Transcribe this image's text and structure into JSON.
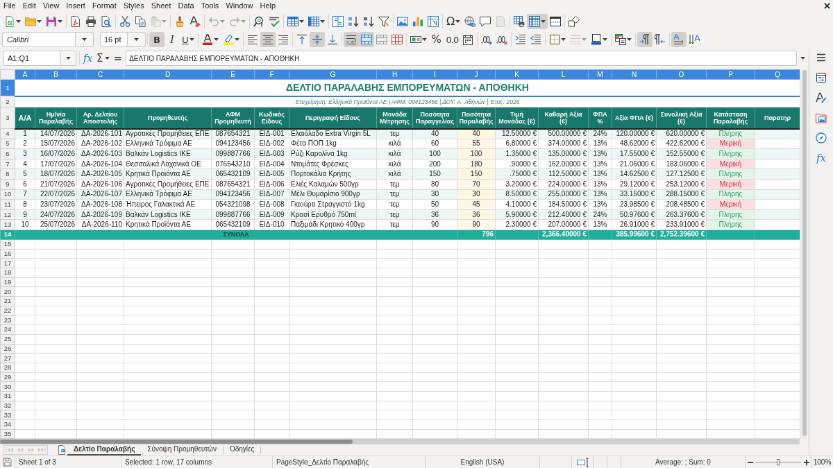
{
  "menu_bar": {
    "items": [
      "File",
      "Edit",
      "View",
      "Insert",
      "Format",
      "Styles",
      "Sheet",
      "Data",
      "Tools",
      "Window",
      "Help"
    ]
  },
  "standard_toolbar": {
    "groups": [
      [
        {
          "kind": "new",
          "on": false,
          "disabled": false
        },
        {
          "kind": "open",
          "on": false,
          "disabled": false
        },
        {
          "kind": "save",
          "on": false,
          "disabled": false
        }
      ],
      [
        {
          "kind": "pdf",
          "on": false,
          "disabled": false
        },
        {
          "kind": "print",
          "on": false,
          "disabled": false
        },
        {
          "kind": "preview",
          "on": false,
          "disabled": false
        }
      ],
      [
        {
          "kind": "cut",
          "on": false,
          "disabled": false
        },
        {
          "kind": "copy",
          "on": false,
          "disabled": false
        },
        {
          "kind": "paste",
          "on": false,
          "disabled": true
        }
      ],
      [
        {
          "kind": "clone",
          "on": false,
          "disabled": false
        },
        {
          "kind": "clear",
          "on": false,
          "disabled": false
        }
      ],
      [
        {
          "kind": "undo",
          "on": false,
          "disabled": true
        },
        {
          "kind": "redo",
          "on": false,
          "disabled": true
        }
      ],
      [
        {
          "kind": "find",
          "on": false,
          "disabled": false
        },
        {
          "kind": "spelling",
          "on": false,
          "disabled": false
        }
      ],
      [
        {
          "kind": "row",
          "on": false,
          "disabled": false
        },
        {
          "kind": "column",
          "on": false,
          "disabled": false
        }
      ],
      [
        {
          "kind": "sort",
          "on": false,
          "disabled": false
        },
        {
          "kind": "ascending",
          "on": false,
          "disabled": false
        },
        {
          "kind": "descending",
          "on": false,
          "disabled": false
        },
        {
          "kind": "filter",
          "on": false,
          "disabled": false
        }
      ],
      [
        {
          "kind": "image",
          "on": false,
          "disabled": false
        },
        {
          "kind": "chart",
          "on": false,
          "disabled": false
        },
        {
          "kind": "pivot",
          "on": false,
          "disabled": false
        }
      ],
      [
        {
          "kind": "special",
          "glyph": "Ω",
          "on": false,
          "disabled": false
        },
        {
          "kind": "link",
          "on": false,
          "disabled": false
        },
        {
          "kind": "comment",
          "on": false,
          "disabled": false
        },
        {
          "kind": "headerfooter",
          "on": false,
          "disabled": true
        }
      ],
      [
        {
          "kind": "printarea",
          "on": false,
          "disabled": false
        },
        {
          "kind": "freeze",
          "on": true,
          "disabled": false
        },
        {
          "kind": "split",
          "on": false,
          "disabled": false
        }
      ],
      [
        {
          "kind": "draw",
          "on": false,
          "disabled": false
        }
      ]
    ]
  },
  "formatting_toolbar": {
    "font_name": "Calibri",
    "font_size": "16 pt",
    "groups": [
      [
        {
          "kind": "bold",
          "glyph": "B",
          "on": true,
          "disabled": false
        },
        {
          "kind": "italic",
          "glyph": "I",
          "on": false,
          "disabled": false
        },
        {
          "kind": "underline",
          "glyph": "U",
          "on": false,
          "disabled": false
        }
      ],
      [
        {
          "kind": "fontcolor",
          "on": false,
          "disabled": false
        },
        {
          "kind": "highlight",
          "on": false,
          "disabled": false
        }
      ],
      [
        {
          "kind": "alignleft",
          "on": false,
          "disabled": false
        },
        {
          "kind": "aligncenter",
          "on": true,
          "disabled": false
        },
        {
          "kind": "alignright",
          "on": false,
          "disabled": false
        }
      ],
      [
        {
          "kind": "aligntop",
          "on": false,
          "disabled": false
        },
        {
          "kind": "alignmiddle",
          "on": true,
          "disabled": false
        },
        {
          "kind": "alignbottom",
          "on": false,
          "disabled": false
        }
      ],
      [
        {
          "kind": "wrap",
          "on": true,
          "disabled": false
        },
        {
          "kind": "mergecenter",
          "on": true,
          "disabled": false
        },
        {
          "kind": "merge",
          "on": false,
          "disabled": false
        },
        {
          "kind": "unmerge",
          "on": false,
          "disabled": false
        }
      ],
      [
        {
          "kind": "currency",
          "on": false,
          "disabled": false
        },
        {
          "kind": "percent",
          "glyph": "%",
          "on": false,
          "disabled": false
        },
        {
          "kind": "number",
          "glyph": "0.0",
          "on": false,
          "disabled": false
        },
        {
          "kind": "date",
          "on": false,
          "disabled": false
        }
      ],
      [
        {
          "kind": "adddecimal",
          "on": false,
          "disabled": false
        },
        {
          "kind": "deletedecimal",
          "on": false,
          "disabled": false
        }
      ],
      [
        {
          "kind": "indent",
          "on": false,
          "disabled": false
        },
        {
          "kind": "outdent",
          "on": false,
          "disabled": false
        }
      ],
      [
        {
          "kind": "borders",
          "on": false,
          "disabled": false
        },
        {
          "kind": "borderstyle",
          "on": false,
          "disabled": true
        },
        {
          "kind": "bordercolor",
          "on": false,
          "disabled": false
        }
      ],
      [
        {
          "kind": "conditional",
          "on": false,
          "disabled": false
        }
      ],
      [
        {
          "kind": "ltr",
          "on": true,
          "disabled": false
        },
        {
          "kind": "rtl",
          "on": false,
          "disabled": false
        }
      ],
      [
        {
          "kind": "textdirection",
          "on": true,
          "disabled": false
        },
        {
          "kind": "verticaltext",
          "on": false,
          "disabled": false
        }
      ]
    ]
  },
  "formula_bar": {
    "name_box": "A1:Q1",
    "function_wizard": "fx",
    "sum": "Σ",
    "formula": "=",
    "content": "ΔΕΛΤΙΟ ΠΑΡΑΛΑΒΗΣ ΕΜΠΟΡΕΥΜΑΤΩΝ - ΑΠΟΘΗΚΗ"
  },
  "sheet": {
    "column_headers": [
      {
        "label": "A",
        "selected": true
      },
      {
        "label": "B",
        "selected": true
      },
      {
        "label": "C",
        "selected": true
      },
      {
        "label": "D",
        "selected": true
      },
      {
        "label": "E",
        "selected": true
      },
      {
        "label": "F",
        "selected": true
      },
      {
        "label": "G",
        "selected": true
      },
      {
        "label": "H",
        "selected": true
      },
      {
        "label": "I",
        "selected": true
      },
      {
        "label": "J",
        "selected": true
      },
      {
        "label": "K",
        "selected": true
      },
      {
        "label": "L",
        "selected": true
      },
      {
        "label": "M",
        "selected": true
      },
      {
        "label": "N",
        "selected": true
      },
      {
        "label": "O",
        "selected": true
      },
      {
        "label": "P",
        "selected": true
      },
      {
        "label": "Q",
        "selected": true
      }
    ],
    "row_headers": [
      {
        "label": "1",
        "selected": true
      },
      {
        "label": "2",
        "selected": false
      },
      {
        "label": "3",
        "selected": false
      },
      {
        "label": "4",
        "selected": false
      },
      {
        "label": "5",
        "selected": false
      },
      {
        "label": "6",
        "selected": false
      },
      {
        "label": "7",
        "selected": false
      },
      {
        "label": "8",
        "selected": false
      },
      {
        "label": "9",
        "selected": false
      },
      {
        "label": "10",
        "selected": false
      },
      {
        "label": "11",
        "selected": false
      },
      {
        "label": "12",
        "selected": false
      },
      {
        "label": "13",
        "selected": false
      },
      {
        "label": "14",
        "selected": false
      },
      {
        "label": "15",
        "selected": false
      },
      {
        "label": "16",
        "selected": false
      },
      {
        "label": "17",
        "selected": false
      },
      {
        "label": "18",
        "selected": false
      },
      {
        "label": "19",
        "selected": false
      },
      {
        "label": "20",
        "selected": false
      },
      {
        "label": "21",
        "selected": false
      },
      {
        "label": "22",
        "selected": false
      },
      {
        "label": "23",
        "selected": false
      },
      {
        "label": "24",
        "selected": false
      },
      {
        "label": "25",
        "selected": false
      },
      {
        "label": "26",
        "selected": false
      },
      {
        "label": "27",
        "selected": false
      },
      {
        "label": "28",
        "selected": false
      },
      {
        "label": "29",
        "selected": false
      },
      {
        "label": "30",
        "selected": false
      },
      {
        "label": "31",
        "selected": false
      },
      {
        "label": "32",
        "selected": false
      },
      {
        "label": "33",
        "selected": false
      },
      {
        "label": "34",
        "selected": false
      },
      {
        "label": "35",
        "selected": false
      }
    ],
    "title": "ΔΕΛΤΙΟ ΠΑΡΑΛΑΒΗΣ ΕΜΠΟΡΕΥΜΑΤΩΝ - ΑΠΟΘΗΚΗ",
    "subtitle": "Επιχείρηση: Ελληνικά Προϊόντα ΑΕ | ΑΦΜ: 094123456 | ΔΟΥ: Α΄ Αθηνών | Έτος: 2026",
    "columns": [
      "Α/Α",
      "Ημ/νία Παραλαβής",
      "Αρ. Δελτίου Αποστολής",
      "Προμηθευτής",
      "ΑΦΜ Προμηθευτή",
      "Κωδικός Είδους",
      "Περιγραφή Είδους",
      "Μονάδα Μέτρησης",
      "Ποσότητα Παραγγελίας",
      "Ποσότητα Παραλαβής",
      "Τιμή Μονάδας (€)",
      "Καθαρή Αξία (€)",
      "ΦΠΑ %",
      "Αξία ΦΠΑ (€)",
      "Συνολική Αξία (€)",
      "Κατάσταση Παραλαβής",
      "Παρατηρ"
    ],
    "rows": [
      {
        "number": "1",
        "date": "14/07/2026",
        "delivery_note": "ΔΑ-2026-101",
        "supplier": "Αγροτικές Προμήθειες ΕΠΕ",
        "vat_number": "087654321",
        "item_code": "ΕΙΔ-001",
        "description": "Ελαιόλαδο Extra Virgin 5L",
        "unit": "τεμ",
        "qty_ordered": "40",
        "qty_received": "40",
        "unit_price": "12.50000 €",
        "net_value": "500.00000 €",
        "vat_rate": "24%",
        "vat_amount": "120.00000 €",
        "total": "620.00000 €",
        "status": {
          "label": "Πλήρης",
          "kind": "complete"
        }
      },
      {
        "number": "2",
        "date": "15/07/2026",
        "delivery_note": "ΔΑ-2026-102",
        "supplier": "Ελληνικά Τρόφιμα ΑΕ",
        "vat_number": "094123456",
        "item_code": "ΕΙΔ-002",
        "description": "Φέτα ΠΟΠ 1kg",
        "unit": "κιλά",
        "qty_ordered": "60",
        "qty_received": "55",
        "unit_price": "6.80000 €",
        "net_value": "374.00000 €",
        "vat_rate": "13%",
        "vat_amount": "48.62000 €",
        "total": "422.62000 €",
        "status": {
          "label": "Μερική",
          "kind": "partial"
        }
      },
      {
        "number": "3",
        "date": "16/07/2026",
        "delivery_note": "ΔΑ-2026-103",
        "supplier": "Βαλκάν Logistics ΙΚΕ",
        "vat_number": "099887766",
        "item_code": "ΕΙΔ-003",
        "description": "Ρύζι Καρολίνα 1kg",
        "unit": "κιλά",
        "qty_ordered": "100",
        "qty_received": "100",
        "unit_price": "1.35000 €",
        "net_value": "135.00000 €",
        "vat_rate": "13%",
        "vat_amount": "17.55000 €",
        "total": "152.55000 €",
        "status": {
          "label": "Πλήρης",
          "kind": "complete"
        }
      },
      {
        "number": "4",
        "date": "17/07/2026",
        "delivery_note": "ΔΑ-2026-104",
        "supplier": "Θεσσαλικά Λαχανικά ΟΕ",
        "vat_number": "076543210",
        "item_code": "ΕΙΔ-004",
        "description": "Ντομάτες Φρέσκες",
        "unit": "κιλά",
        "qty_ordered": "200",
        "qty_received": "180",
        "unit_price": ".90000 €",
        "net_value": "162.00000 €",
        "vat_rate": "13%",
        "vat_amount": "21.06000 €",
        "total": "183.06000 €",
        "status": {
          "label": "Μερική",
          "kind": "partial"
        }
      },
      {
        "number": "5",
        "date": "18/07/2026",
        "delivery_note": "ΔΑ-2026-105",
        "supplier": "Κρητικά Προϊόντα ΑΕ",
        "vat_number": "065432109",
        "item_code": "ΕΙΔ-005",
        "description": "Πορτοκάλια Κρήτης",
        "unit": "κιλά",
        "qty_ordered": "150",
        "qty_received": "150",
        "unit_price": ".75000 €",
        "net_value": "112.50000 €",
        "vat_rate": "13%",
        "vat_amount": "14.62500 €",
        "total": "127.12500 €",
        "status": {
          "label": "Πλήρης",
          "kind": "complete"
        }
      },
      {
        "number": "6",
        "date": "21/07/2026",
        "delivery_note": "ΔΑ-2026-106",
        "supplier": "Αγροτικές Προμήθειες ΕΠΕ",
        "vat_number": "087654321",
        "item_code": "ΕΙΔ-006",
        "description": "Ελιές Καλαμών 500γρ",
        "unit": "τεμ",
        "qty_ordered": "80",
        "qty_received": "70",
        "unit_price": "3.20000 €",
        "net_value": "224.00000 €",
        "vat_rate": "13%",
        "vat_amount": "29.12000 €",
        "total": "253.12000 €",
        "status": {
          "label": "Μερική",
          "kind": "partial"
        }
      },
      {
        "number": "7",
        "date": "22/07/2026",
        "delivery_note": "ΔΑ-2026-107",
        "supplier": "Ελληνικά Τρόφιμα ΑΕ",
        "vat_number": "094123456",
        "item_code": "ΕΙΔ-007",
        "description": "Μέλι Θυμαρίσιο 900γρ",
        "unit": "τεμ",
        "qty_ordered": "30",
        "qty_received": "30",
        "unit_price": "8.50000 €",
        "net_value": "255.00000 €",
        "vat_rate": "13%",
        "vat_amount": "33.15000 €",
        "total": "288.15000 €",
        "status": {
          "label": "Πλήρης",
          "kind": "complete"
        }
      },
      {
        "number": "8",
        "date": "23/07/2026",
        "delivery_note": "ΔΑ-2026-108",
        "supplier": "Ήπειρος Γαλακτικά ΑΕ",
        "vat_number": "054321098",
        "item_code": "ΕΙΔ-008",
        "description": "Γιαούρτι Στραγγιστό 1kg",
        "unit": "τεμ",
        "qty_ordered": "50",
        "qty_received": "45",
        "unit_price": "4.10000 €",
        "net_value": "184.50000 €",
        "vat_rate": "13%",
        "vat_amount": "23.98500 €",
        "total": "208.48500 €",
        "status": {
          "label": "Μερική",
          "kind": "partial"
        }
      },
      {
        "number": "9",
        "date": "24/07/2026",
        "delivery_note": "ΔΑ-2026-109",
        "supplier": "Βαλκάν Logistics ΙΚΕ",
        "vat_number": "099887766",
        "item_code": "ΕΙΔ-009",
        "description": "Κρασί Ερυθρό 750ml",
        "unit": "τεμ",
        "qty_ordered": "36",
        "qty_received": "36",
        "unit_price": "5.90000 €",
        "net_value": "212.40000 €",
        "vat_rate": "24%",
        "vat_amount": "50.97600 €",
        "total": "263.37600 €",
        "status": {
          "label": "Πλήρης",
          "kind": "complete"
        }
      },
      {
        "number": "10",
        "date": "25/07/2026",
        "delivery_note": "ΔΑ-2026-110",
        "supplier": "Κρητικά Προϊόντα ΑΕ",
        "vat_number": "065432109",
        "item_code": "ΕΙΔ-010",
        "description": "Παξιμάδι Κρητικό 400γρ",
        "unit": "τεμ",
        "qty_ordered": "90",
        "qty_received": "90",
        "unit_price": "2.30000 €",
        "net_value": "207.00000 €",
        "vat_rate": "13%",
        "vat_amount": "26.91000 €",
        "total": "233.91000 €",
        "status": {
          "label": "Πλήρης",
          "kind": "complete"
        }
      }
    ],
    "totals": {
      "label": "ΣΥΝΟΛΑ",
      "qty_received": "796",
      "net_value": "2,366.40000 €",
      "vat_amount": "385.99600 €",
      "total": "2,752.39600 €"
    }
  },
  "sheet_tabs": {
    "navigation": [
      {
        "kind": "first",
        "disabled": true
      },
      {
        "kind": "previous",
        "disabled": true
      },
      {
        "kind": "next",
        "disabled": true
      },
      {
        "kind": "last",
        "disabled": true
      }
    ],
    "tabs": [
      {
        "label": "Δελτίο Παραλαβής",
        "selected": true
      },
      {
        "label": "Σύνοψη Προμηθευτών",
        "selected": false
      },
      {
        "label": "Οδηγίες",
        "selected": false
      }
    ]
  },
  "sidebar": {
    "items": [
      {
        "kind": "menu"
      },
      {
        "kind": "properties"
      },
      {
        "kind": "styles"
      },
      {
        "kind": "gallery"
      },
      {
        "kind": "navigator"
      },
      {
        "kind": "functions",
        "glyph": "fx"
      }
    ]
  },
  "status_bar": {
    "sheet": "Sheet 1 of 3",
    "selection": "Selected: 1 row, 17 columns",
    "page_style": "PageStyle_Δελτίο Παραλαβής",
    "language": "English (USA)",
    "statistics": "Average: ; Sum: 0",
    "zoom": {
      "level": 0.5,
      "reading": "100%"
    }
  }
}
